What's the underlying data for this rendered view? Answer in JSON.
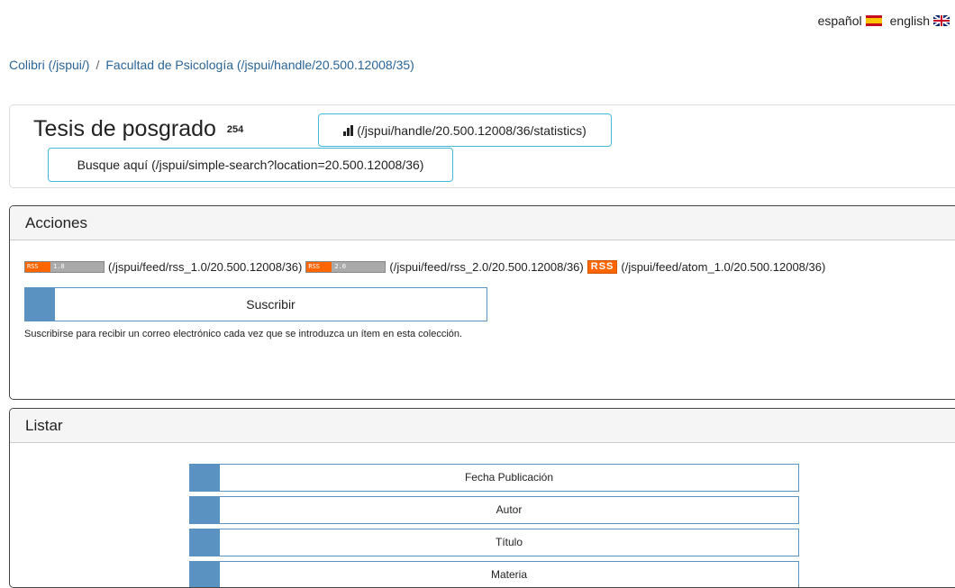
{
  "lang": {
    "es": "español",
    "en": "english"
  },
  "breadcrumb": [
    {
      "label": "Colibri (/jspui/)"
    },
    {
      "label": "Facultad de Psicología (/jspui/handle/20.500.12008/35)"
    }
  ],
  "breadcrumb_sep": "/",
  "collection": {
    "title": "Tesis de posgrado",
    "count": "254",
    "stats_label": "(/jspui/handle/20.500.12008/36/statistics)",
    "search_label": "Busque aquí (/jspui/simple-search?location=20.500.12008/36)"
  },
  "acciones": {
    "heading": "Acciones",
    "feeds": [
      {
        "badge_left": "RSS",
        "badge_right": "1.0",
        "link": "(/jspui/feed/rss_1.0/20.500.12008/36)"
      },
      {
        "badge_left": "RSS",
        "badge_right": "2.0",
        "link": "(/jspui/feed/rss_2.0/20.500.12008/36)"
      },
      {
        "badge": "RSS",
        "link": "(/jspui/feed/atom_1.0/20.500.12008/36)"
      }
    ],
    "subscribe_label": "Suscribir",
    "subscribe_desc": "Suscribirse para recibir un correo electrónico cada vez que se introduzca un ítem en esta colección."
  },
  "listar": {
    "heading": "Listar",
    "items": [
      "Fecha Publicación",
      "Autor",
      "Título",
      "Materia"
    ]
  },
  "colors": {
    "accent": "#5a93c2",
    "info_border": "#46b8da",
    "rss": "#ff6600",
    "link": "#2a6496"
  }
}
